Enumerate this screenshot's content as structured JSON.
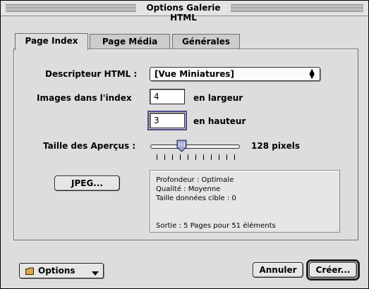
{
  "window": {
    "title": "Options Galerie HTML"
  },
  "tabs": [
    {
      "label": "Page Index",
      "active": true
    },
    {
      "label": "Page Média",
      "active": false
    },
    {
      "label": "Générales",
      "active": false
    }
  ],
  "form": {
    "descripteur_label": "Descripteur HTML :",
    "descripteur_value": "[Vue Miniatures]",
    "images_label": "Images dans l'index",
    "largeur_value": "4",
    "largeur_suffix": "en largeur",
    "hauteur_value": "3",
    "hauteur_suffix": "en hauteur",
    "taille_label": "Taille des Aperçus :",
    "taille_value": "128 pixels",
    "taille_slider_level": 0.35
  },
  "jpeg_button": "JPEG...",
  "info": {
    "profondeur": "Profondeur : Optimale",
    "qualite": "Qualité : Moyenne",
    "taille": "Taille données cible : 0",
    "sortie": "Sortie : 5 Pages pour 51 éléments"
  },
  "footer": {
    "options_label": "Options",
    "cancel_label": "Annuler",
    "create_label": "Créer..."
  },
  "icons": {
    "popup_arrows": "up-down-arrows-icon",
    "options_folder": "folder-icon",
    "options_menu": "triangle-down-icon"
  }
}
